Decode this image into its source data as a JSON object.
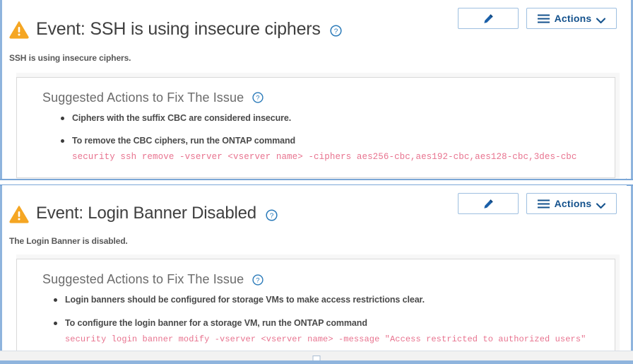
{
  "window": {
    "bottom_grip": "resize-grip"
  },
  "panels": [
    {
      "icon": "warning-triangle-icon",
      "title": "Event: SSH is using insecure ciphers",
      "help_icon": "help-circle-icon",
      "description": "SSH is using insecure ciphers.",
      "buttons": {
        "edit_icon": "pencil-icon",
        "actions_icon": "hamburger-icon",
        "actions_label": "Actions",
        "actions_chevron": "chevron-down-icon"
      },
      "suggested": {
        "heading": "Suggested Actions to Fix The Issue",
        "help_icon": "help-circle-icon",
        "items": [
          {
            "text": "Ciphers with the suffix CBC are considered insecure.",
            "code": ""
          },
          {
            "text": "To remove the CBC ciphers, run the ONTAP command",
            "code": "security ssh remove -vserver <vserver name> -ciphers aes256-cbc,aes192-cbc,aes128-cbc,3des-cbc"
          }
        ]
      }
    },
    {
      "icon": "warning-triangle-icon",
      "title": "Event: Login Banner Disabled",
      "help_icon": "help-circle-icon",
      "description": "The Login Banner is disabled.",
      "buttons": {
        "edit_icon": "pencil-icon",
        "actions_icon": "hamburger-icon",
        "actions_label": "Actions",
        "actions_chevron": "chevron-down-icon"
      },
      "suggested": {
        "heading": "Suggested Actions to Fix The Issue",
        "help_icon": "help-circle-icon",
        "items": [
          {
            "text": "Login banners should be configured for storage VMs to make access restrictions clear.",
            "code": ""
          },
          {
            "text": "To configure the login banner for a storage VM, run the ONTAP command",
            "code": "security login banner modify -vserver <vserver name> -message \"Access restricted to authorized users\""
          }
        ]
      }
    }
  ],
  "colors": {
    "warning": "#f5a623",
    "link_blue": "#1a6fb5",
    "button_blue": "#13518c",
    "code_pink": "#e8738f",
    "divider_blue": "#7ba7d7"
  }
}
